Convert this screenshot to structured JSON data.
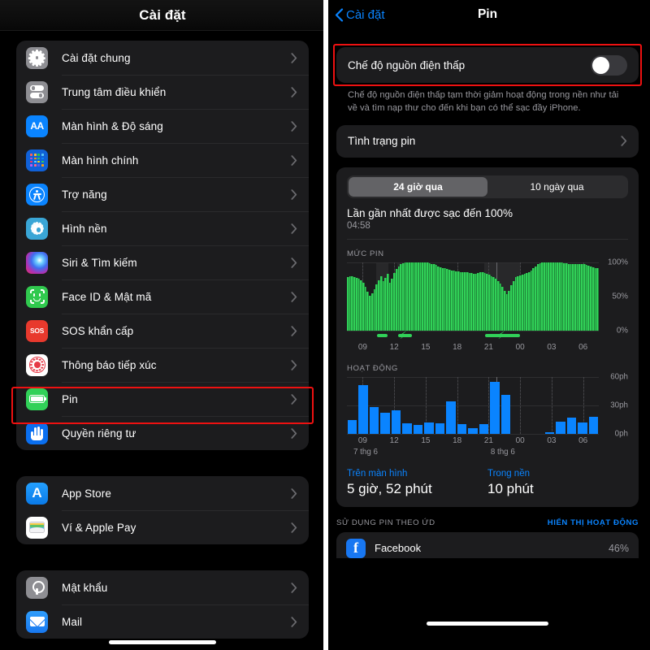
{
  "left": {
    "header_title": "Cài đặt",
    "groups": [
      {
        "items": [
          {
            "label": "Cài đặt chung",
            "icon": "gear-icon"
          },
          {
            "label": "Trung tâm điều khiển",
            "icon": "control-center-icon"
          },
          {
            "label": "Màn hình & Độ sáng",
            "icon": "display-brightness-icon"
          },
          {
            "label": "Màn hình chính",
            "icon": "home-screen-icon"
          },
          {
            "label": "Trợ năng",
            "icon": "accessibility-icon"
          },
          {
            "label": "Hình nền",
            "icon": "wallpaper-icon"
          },
          {
            "label": "Siri & Tìm kiếm",
            "icon": "siri-icon"
          },
          {
            "label": "Face ID & Mật mã",
            "icon": "face-id-icon"
          },
          {
            "label": "SOS khẩn cấp",
            "icon": "sos-icon"
          },
          {
            "label": "Thông báo tiếp xúc",
            "icon": "exposure-notification-icon"
          },
          {
            "label": "Pin",
            "icon": "battery-icon",
            "highlighted": true
          },
          {
            "label": "Quyền riêng tư",
            "icon": "privacy-hand-icon"
          }
        ]
      },
      {
        "items": [
          {
            "label": "App Store",
            "icon": "app-store-icon"
          },
          {
            "label": "Ví & Apple Pay",
            "icon": "wallet-icon"
          }
        ]
      },
      {
        "items": [
          {
            "label": "Mật khẩu",
            "icon": "key-icon"
          },
          {
            "label": "Mail",
            "icon": "mail-icon"
          }
        ]
      }
    ]
  },
  "right": {
    "back_label": "Cài đặt",
    "title": "Pin",
    "low_power": {
      "label": "Chế độ nguồn điện thấp",
      "enabled": false,
      "footnote": "Chế độ nguồn điện thấp tạm thời giảm hoạt động trong nền như tải về và tìm nạp thư cho đến khi bạn có thể sạc đầy iPhone."
    },
    "battery_health_label": "Tình trạng pin",
    "segments": [
      {
        "label": "24 giờ qua",
        "active": true
      },
      {
        "label": "10 ngày qua",
        "active": false
      }
    ],
    "last_charge_title": "Lần gần nhất được sạc đến 100%",
    "last_charge_time": "04:58",
    "battery_level_label": "MỨC PIN",
    "activity_label": "HOẠT ĐỘNG",
    "stats": [
      {
        "key": "Trên màn hình",
        "value": "5 giờ, 52 phút"
      },
      {
        "key": "Trong nền",
        "value": "10 phút"
      }
    ],
    "usage_header": "SỬ DỤNG PIN THEO ỨD",
    "usage_action": "HIỂN THỊ HOẠT ĐỘNG",
    "apps": [
      {
        "name": "Facebook",
        "percent": "46%",
        "letter": "f",
        "color": "#1877f2"
      }
    ]
  },
  "colors": {
    "accent_blue": "#0a84ff",
    "battery_green": "#31d158",
    "activity_blue": "#0a84ff",
    "highlight_red": "#ee1111",
    "card_bg": "#1c1c1e"
  },
  "chart_data": [
    {
      "type": "bar",
      "title": "MỨC PIN",
      "xlabel": "",
      "ylabel": "",
      "ylim": [
        0,
        100
      ],
      "ytick_labels": [
        "100%",
        "50%",
        "0%"
      ],
      "ytick_values": [
        100,
        50,
        0
      ],
      "xtick_labels": [
        "09",
        "12",
        "15",
        "18",
        "21",
        "00",
        "03",
        "06"
      ],
      "color": "#31d158",
      "grid": true,
      "values": [
        78,
        79,
        79,
        78,
        77,
        76,
        74,
        70,
        64,
        57,
        51,
        54,
        61,
        68,
        74,
        79,
        72,
        77,
        83,
        70,
        76,
        84,
        90,
        94,
        97,
        99,
        100,
        100,
        100,
        100,
        100,
        100,
        100,
        100,
        100,
        100,
        100,
        99,
        98,
        97,
        96,
        94,
        93,
        92,
        91,
        90,
        89,
        88,
        88,
        87,
        87,
        86,
        86,
        85,
        85,
        84,
        84,
        83,
        83,
        84,
        85,
        85,
        84,
        83,
        82,
        80,
        78,
        76,
        73,
        69,
        64,
        58,
        53,
        58,
        66,
        73,
        78,
        80,
        81,
        82,
        83,
        84,
        86,
        88,
        91,
        94,
        97,
        99,
        100,
        100,
        100,
        100,
        100,
        100,
        100,
        100,
        100,
        100,
        99,
        99,
        98,
        98,
        98,
        97,
        97,
        98,
        98,
        97,
        96,
        95,
        94,
        93,
        92,
        91
      ],
      "charging_spans": [
        [
          0.115,
          0.165
        ],
        [
          0.2,
          0.26
        ],
        [
          0.545,
          0.69
        ]
      ],
      "charging_bolts": [
        0.225,
        0.615
      ]
    },
    {
      "type": "bar",
      "title": "HOẠT ĐỘNG",
      "xlabel": "",
      "ylabel": "",
      "ylim": [
        0,
        60
      ],
      "ytick_labels": [
        "60ph",
        "30ph",
        "0ph"
      ],
      "ytick_values": [
        60,
        30,
        0
      ],
      "xtick_labels": [
        "09",
        "12",
        "15",
        "18",
        "21",
        "00",
        "03",
        "06"
      ],
      "xaxis_day_labels": [
        "7 thg 6",
        "8 thg 6"
      ],
      "color": "#0a84ff",
      "grid": true,
      "values": [
        14,
        51,
        28,
        22,
        25,
        11,
        9,
        12,
        11,
        34,
        10,
        6,
        10,
        55,
        41,
        0,
        0,
        0,
        1,
        13,
        17,
        12,
        18
      ]
    }
  ]
}
